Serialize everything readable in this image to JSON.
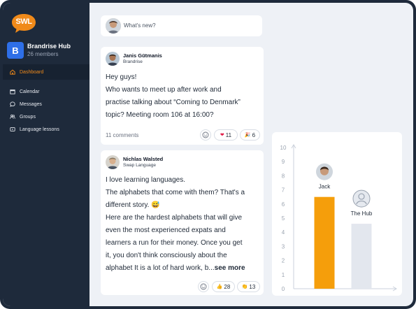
{
  "brand": {
    "logo_text": "SWL",
    "logo_color": "#f08a1a"
  },
  "hub": {
    "badge": "B",
    "name": "Brandrise Hub",
    "members": "26 members"
  },
  "nav": {
    "items": [
      {
        "label": "Dashboard",
        "icon": "home-icon",
        "active": true
      },
      {
        "label": "Calendar",
        "icon": "calendar-icon"
      },
      {
        "label": "Messages",
        "icon": "chat-icon"
      },
      {
        "label": "Groups",
        "icon": "users-icon"
      },
      {
        "label": "Language lessons",
        "icon": "video-icon"
      }
    ]
  },
  "composer": {
    "placeholder": "What's new?"
  },
  "posts": [
    {
      "author": "Janis Gūtmanis",
      "org": "Brandrise",
      "lines": [
        "Hey guys!",
        "Who wants to meet up after work and",
        "practise talking about “Coming to Denmark”",
        "topic? Meeting room 106 at 16:00?"
      ],
      "comments": "11 comments",
      "reactions": [
        {
          "emoji": "heart-emoji",
          "count": "11"
        },
        {
          "emoji": "party-emoji",
          "count": "6"
        }
      ]
    },
    {
      "author": "Nichlas Walsted",
      "org": "Swap Language",
      "lines": [
        "I love learning languages.",
        "The alphabets that come with them? That's a",
        "different story. 😅",
        "Here are the hardest alphabets that will give",
        "even the most experienced expats and",
        "learners a run for their money. Once you get",
        "it, you don't think consciously about the"
      ],
      "last_line": "alphabet It is a lot of hard work, b...",
      "see_more": "see more",
      "reactions": [
        {
          "emoji": "thumbs-up-emoji",
          "count": "28"
        },
        {
          "emoji": "clap-emoji",
          "count": "13"
        }
      ]
    }
  ],
  "chart_data": {
    "type": "bar",
    "categories": [
      "Jack",
      "The Hub"
    ],
    "values": [
      6.5,
      4.6
    ],
    "colors": [
      "#f59e0b",
      "#e3e7ee"
    ],
    "ylim": [
      0,
      10
    ],
    "yticks": [
      "0",
      "1",
      "2",
      "3",
      "4",
      "5",
      "6",
      "7",
      "8",
      "9",
      "10"
    ],
    "grid": false
  }
}
